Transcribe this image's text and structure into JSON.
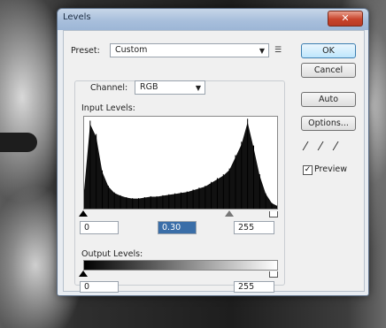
{
  "window": {
    "title": "Levels",
    "close_label": "✕"
  },
  "preset": {
    "label": "Preset:",
    "value": "Custom",
    "menu_icon": "menu-icon"
  },
  "buttons": {
    "ok": "OK",
    "cancel": "Cancel",
    "auto": "Auto",
    "options": "Options..."
  },
  "channel": {
    "label": "Channel:",
    "value": "RGB"
  },
  "input_levels": {
    "label": "Input Levels:",
    "black": "0",
    "gray": "0.30",
    "white": "255"
  },
  "output_levels": {
    "label": "Output Levels:",
    "black": "0",
    "white": "255"
  },
  "preview": {
    "label": "Preview",
    "checked": true
  },
  "chart_data": {
    "type": "area",
    "x": [
      0,
      8,
      16,
      24,
      32,
      40,
      48,
      56,
      64,
      72,
      80,
      88,
      96,
      104,
      112,
      120,
      128,
      136,
      144,
      152,
      160,
      168,
      176,
      184,
      192,
      200,
      208,
      216,
      224,
      232,
      240,
      248,
      255
    ],
    "values": [
      20,
      92,
      78,
      40,
      24,
      17,
      14,
      12,
      11,
      11,
      12,
      13,
      13,
      14,
      15,
      16,
      17,
      18,
      20,
      22,
      24,
      28,
      32,
      36,
      42,
      56,
      70,
      94,
      66,
      36,
      16,
      6,
      3
    ],
    "xlim": [
      0,
      255
    ],
    "ylim": [
      0,
      100
    ]
  }
}
